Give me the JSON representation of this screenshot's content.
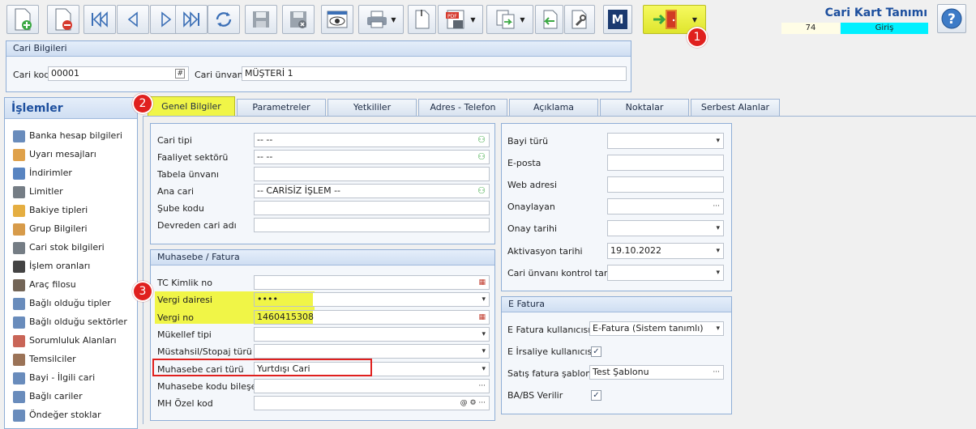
{
  "header": {
    "title": "Cari Kart Tanımı",
    "record_number": "74",
    "mode": "Giriş",
    "help_icon": "help-icon"
  },
  "toolbar": {
    "buttons": [
      "new-document-icon",
      "delete-icon",
      "first-record-icon",
      "previous-record-icon",
      "next-record-icon",
      "last-record-icon",
      "refresh-icon",
      "save-icon",
      "cancel-save-icon",
      "preview-icon",
      "print-icon",
      "blank-page-icon",
      "pdf-export-icon",
      "copy-icon",
      "back-icon",
      "tools-icon",
      "m-icon",
      "exit-door-icon"
    ],
    "m_label": "M"
  },
  "cari_bilgileri": {
    "title": "Cari Bilgileri",
    "kod_label": "Cari kod",
    "kod_value": "00001",
    "kod_btn": "#",
    "unvan_label": "Cari ünvanı",
    "unvan_value": "MÜŞTERİ 1"
  },
  "sidebar": {
    "title": "İşlemler",
    "items": [
      {
        "label": "Banka hesap bilgileri",
        "icon": "bank-icon"
      },
      {
        "label": "Uyarı mesajları",
        "icon": "warning-icon"
      },
      {
        "label": "İndirimler",
        "icon": "discount-icon"
      },
      {
        "label": "Limitler",
        "icon": "limits-icon"
      },
      {
        "label": "Bakiye tipleri",
        "icon": "balance-icon"
      },
      {
        "label": "Grup Bilgileri",
        "icon": "group-icon"
      },
      {
        "label": "Cari stok bilgileri",
        "icon": "stock-icon"
      },
      {
        "label": "İşlem oranları",
        "icon": "percent-icon"
      },
      {
        "label": "Araç filosu",
        "icon": "vehicle-icon"
      },
      {
        "label": "Bağlı olduğu tipler",
        "icon": "linked-types-icon"
      },
      {
        "label": "Bağlı olduğu sektörler",
        "icon": "linked-sectors-icon"
      },
      {
        "label": "Sorumluluk Alanları",
        "icon": "responsibility-icon"
      },
      {
        "label": "Temsilciler",
        "icon": "representative-icon"
      },
      {
        "label": "Bayi - İlgili cari",
        "icon": "dealer-icon"
      },
      {
        "label": "Bağlı cariler",
        "icon": "linked-accounts-icon"
      },
      {
        "label": "Öndeğer stoklar",
        "icon": "default-stock-icon"
      }
    ]
  },
  "tabs": [
    "Genel Bilgiler",
    "Parametreler",
    "Yetkililer",
    "Adres - Telefon",
    "Açıklama",
    "Noktalar",
    "Serbest Alanlar"
  ],
  "general": {
    "fields": [
      {
        "label": "Cari tipi",
        "value": "-- --"
      },
      {
        "label": "Faaliyet sektörü",
        "value": "-- --"
      },
      {
        "label": "Tabela ünvanı",
        "value": ""
      },
      {
        "label": "Ana cari",
        "value": "-- CARİSİZ İŞLEM --"
      },
      {
        "label": "Şube kodu",
        "value": ""
      },
      {
        "label": "Devreden cari adı",
        "value": ""
      }
    ]
  },
  "muhasebe": {
    "title": "Muhasebe / Fatura",
    "fields": [
      {
        "label": "TC Kimlik no",
        "value": ""
      },
      {
        "label": "Vergi dairesi",
        "value": "••••"
      },
      {
        "label": "Vergi no",
        "value": "1460415308"
      },
      {
        "label": "Mükellef tipi",
        "value": ""
      },
      {
        "label": "Müstahsil/Stopaj türü",
        "value": ""
      },
      {
        "label": "Muhasebe cari türü",
        "value": "Yurtdışı Cari"
      },
      {
        "label": "Muhasebe kodu bileşeni",
        "value": ""
      },
      {
        "label": "MH Özel kod",
        "value": ""
      }
    ]
  },
  "right_panel": {
    "fields": [
      {
        "label": "Bayi türü",
        "value": ""
      },
      {
        "label": "E-posta",
        "value": ""
      },
      {
        "label": "Web adresi",
        "value": ""
      },
      {
        "label": "Onaylayan",
        "value": ""
      },
      {
        "label": "Onay tarihi",
        "value": ""
      },
      {
        "label": "Aktivasyon tarihi",
        "value": "19.10.2022"
      },
      {
        "label": "Cari ünvanı kontrol tarihi",
        "value": ""
      }
    ]
  },
  "efatura": {
    "title": "E Fatura",
    "kullanici_label": "E Fatura kullanıcısı",
    "kullanici_value": "E-Fatura (Sistem tanımlı)",
    "irsaliye_label": "E İrsaliye kullanıcısı",
    "sablon_label": "Satış fatura şablonu",
    "sablon_value": "Test Şablonu",
    "babs_label": "BA/BS Verilir"
  },
  "annotations": [
    "1",
    "2",
    "3"
  ],
  "colors": {
    "accent": "#1d4f9e",
    "highlight": "#f0f547",
    "mode_bg": "#00f0ff",
    "badge": "#e0201e",
    "outline": "#e0201e"
  }
}
